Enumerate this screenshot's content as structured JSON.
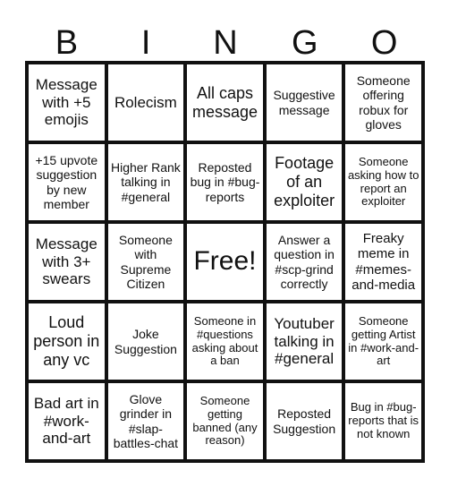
{
  "header": [
    "B",
    "I",
    "N",
    "G",
    "O"
  ],
  "cells": [
    "Message with +5 emojis",
    "Rolecism",
    "All caps message",
    "Suggestive message",
    "Someone offering robux for gloves",
    "+15 upvote suggestion by new member",
    "Higher Rank talking in #general",
    "Reposted bug in #bug-reports",
    "Footage of an exploiter",
    "Someone asking how to report an exploiter",
    "Message with 3+ swears",
    "Someone with Supreme Citizen",
    "Free!",
    "Answer a question in #scp-grind correctly",
    "Freaky meme in #memes-and-media",
    "Loud person in any vc",
    "Joke Suggestion",
    "Someone in #questions asking about a ban",
    "Youtuber talking in #general",
    "Someone getting Artist in #work-and-art",
    "Bad art in #work-and-art",
    "Glove grinder in #slap-battles-chat",
    "Someone getting banned (any reason)",
    "Reposted Suggestion",
    "Bug in #bug-reports that is not known"
  ]
}
